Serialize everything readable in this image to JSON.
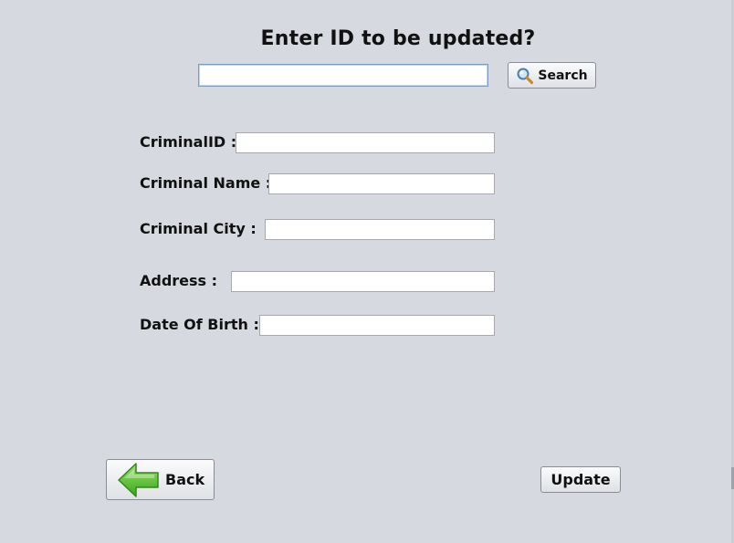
{
  "header": {
    "title": "Enter ID to be updated?"
  },
  "search": {
    "value": "",
    "button_label": "Search",
    "icon": "magnifier-icon"
  },
  "form": {
    "criminal_id_label": "CriminalID :",
    "criminal_id_value": "",
    "criminal_name_label": "Criminal Name :",
    "criminal_name_value": "",
    "criminal_city_label": "Criminal City :",
    "criminal_city_value": "",
    "address_label": "Address :",
    "address_value": "",
    "dob_label": "Date Of Birth :",
    "dob_value": ""
  },
  "actions": {
    "back_label": "Back",
    "back_icon": "left-arrow-icon",
    "update_label": "Update"
  },
  "colors": {
    "background": "#d6d9e0",
    "arrow_green": "#5cc832"
  }
}
